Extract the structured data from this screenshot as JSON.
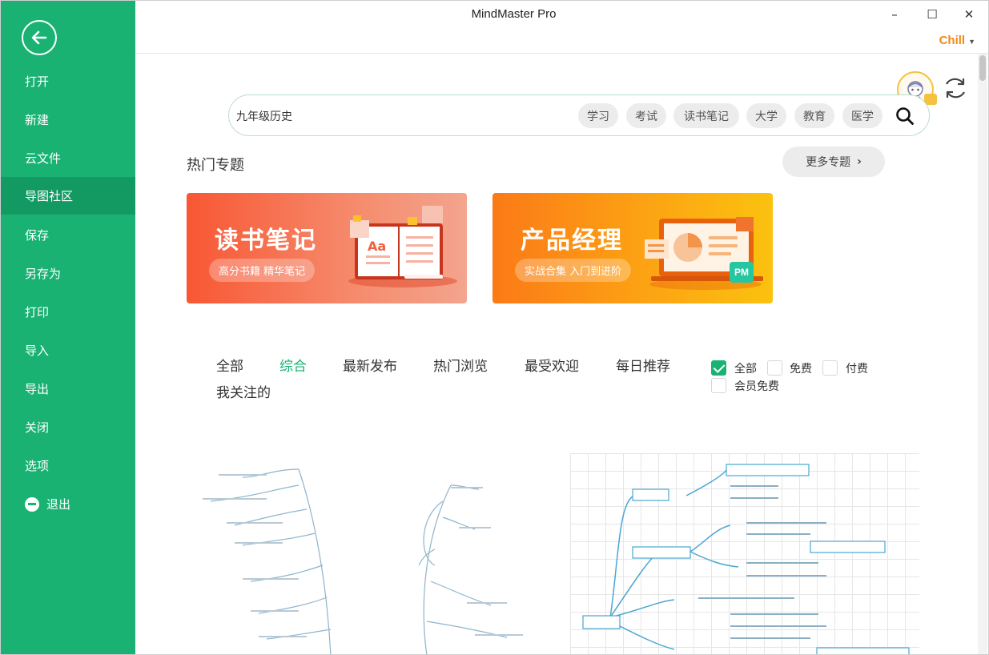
{
  "window": {
    "title": "MindMaster Pro",
    "controls": {
      "minimize": "–",
      "maximize": "☐",
      "close": "✕"
    },
    "user": "Chill"
  },
  "sidebar": {
    "items": [
      {
        "label": "打开"
      },
      {
        "label": "新建"
      },
      {
        "label": "云文件"
      },
      {
        "label": "导图社区",
        "active": true
      },
      {
        "label": "保存"
      },
      {
        "label": "另存为"
      },
      {
        "label": "打印"
      },
      {
        "label": "导入"
      },
      {
        "label": "导出"
      },
      {
        "label": "关闭"
      },
      {
        "label": "选项"
      },
      {
        "label": "退出"
      }
    ]
  },
  "search": {
    "value": "九年级历史",
    "tags": [
      "学习",
      "考试",
      "读书笔记",
      "大学",
      "教育",
      "医学"
    ]
  },
  "hot": {
    "title": "热门专题",
    "more": "更多专题",
    "banners": [
      {
        "title": "读书笔记",
        "subtitle": "高分书籍 精华笔记"
      },
      {
        "title": "产品经理",
        "subtitle": "实战合集 入门到进阶",
        "badge": "PM"
      }
    ]
  },
  "filters": {
    "tabs": [
      "全部",
      "综合",
      "最新发布",
      "热门浏览",
      "最受欢迎",
      "每日推荐",
      "我关注的"
    ],
    "active_tab": "综合",
    "checkboxes": [
      {
        "label": "全部",
        "checked": true
      },
      {
        "label": "免费",
        "checked": false
      },
      {
        "label": "付费",
        "checked": false
      },
      {
        "label": "会员免费",
        "checked": false
      }
    ]
  },
  "colors": {
    "accent": "#19b273",
    "user": "#f08a18",
    "banner1": "#f85734",
    "banner2": "#fb7a17"
  }
}
